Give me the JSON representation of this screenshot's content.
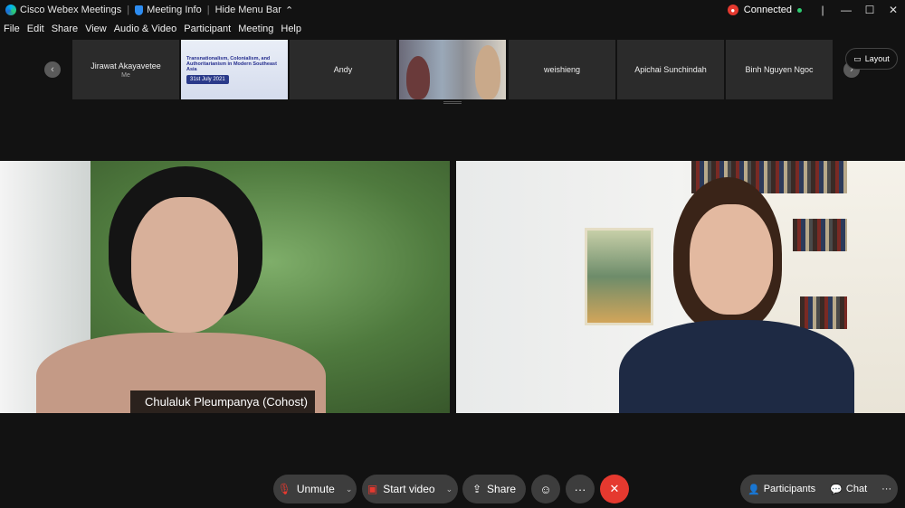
{
  "titlebar": {
    "app_title": "Cisco Webex Meetings",
    "meeting_info": "Meeting Info",
    "hide_menu_bar": "Hide Menu Bar",
    "status": "Connected"
  },
  "menu": {
    "items": [
      "File",
      "Edit",
      "Share",
      "View",
      "Audio & Video",
      "Participant",
      "Meeting",
      "Help"
    ]
  },
  "filmstrip": {
    "layout_label": "Layout",
    "tiles": [
      {
        "name": "Jirawat Akayavetee",
        "sub": "Me"
      },
      {
        "name": "",
        "sub": ""
      },
      {
        "name": "Andy",
        "sub": ""
      },
      {
        "name": "",
        "sub": ""
      },
      {
        "name": "weishieng",
        "sub": ""
      },
      {
        "name": "Apichai Sunchindah",
        "sub": ""
      },
      {
        "name": "Binh Nguyen Ngoc",
        "sub": ""
      }
    ],
    "poster": {
      "title": "Transnationalism, Colonialism, and Authoritarianism in Modern Southeast Asia",
      "date": "31st July 2021"
    }
  },
  "main_video": {
    "left_name": "Chulaluk Pleumpanya (Cohost)"
  },
  "controls": {
    "unmute": "Unmute",
    "start_video": "Start video",
    "share": "Share",
    "more": "···",
    "participants": "Participants",
    "chat": "Chat"
  },
  "colors": {
    "background": "#121212",
    "tile": "#2b2b2b",
    "control": "#3d3d3d",
    "leave_red": "#e5392f",
    "connected_green": "#2ecc71"
  }
}
